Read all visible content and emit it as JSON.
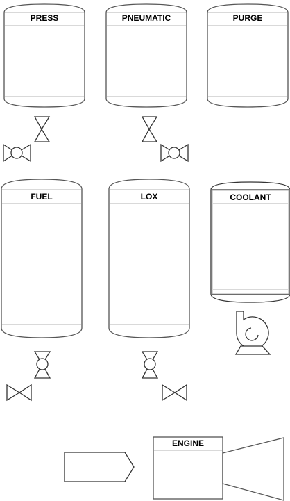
{
  "tanks": {
    "press": {
      "label": "PRESS"
    },
    "pneumatic": {
      "label": "PNEUMATIC"
    },
    "purge": {
      "label": "PURGE"
    },
    "fuel": {
      "label": "FUEL"
    },
    "lox": {
      "label": "LOX"
    },
    "coolant": {
      "label": "COOLANT"
    }
  },
  "engine": {
    "label": "ENGINE"
  }
}
